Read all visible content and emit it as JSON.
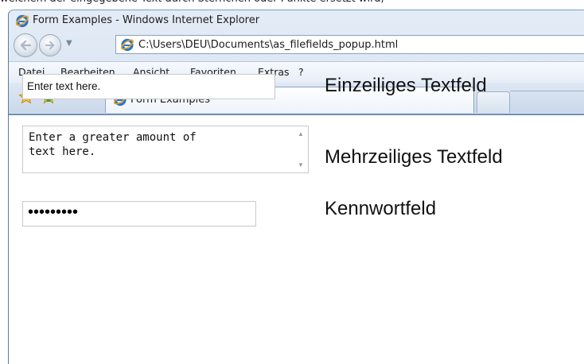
{
  "top_caption": "welchem der eingegebene Text durch Sternchen oder Punkte ersetzt wird,",
  "window": {
    "title": "Form Examples - Windows Internet Explorer",
    "address": "C:\\Users\\DEU\\Documents\\as_filefields_popup.html"
  },
  "menu": [
    {
      "label": "Datei"
    },
    {
      "label": "Bearbeiten"
    },
    {
      "label": "Ansicht"
    },
    {
      "label": "Favoriten"
    },
    {
      "label": "Extras"
    },
    {
      "label": "?"
    }
  ],
  "tab": {
    "label": "Form Examples"
  },
  "form": {
    "single_value": "Enter text here.",
    "single_label": "Einzeiliges Textfeld",
    "multi_value": "Enter a greater amount of\ntext here.",
    "multi_label": "Mehrzeiliges Textfeld",
    "password_value": "•••••••••",
    "password_label": "Kennwortfeld"
  },
  "colors": {
    "accent": "#1e5aa8",
    "ie_blue": "#2a74c7",
    "ie_orange": "#f3a21c"
  }
}
